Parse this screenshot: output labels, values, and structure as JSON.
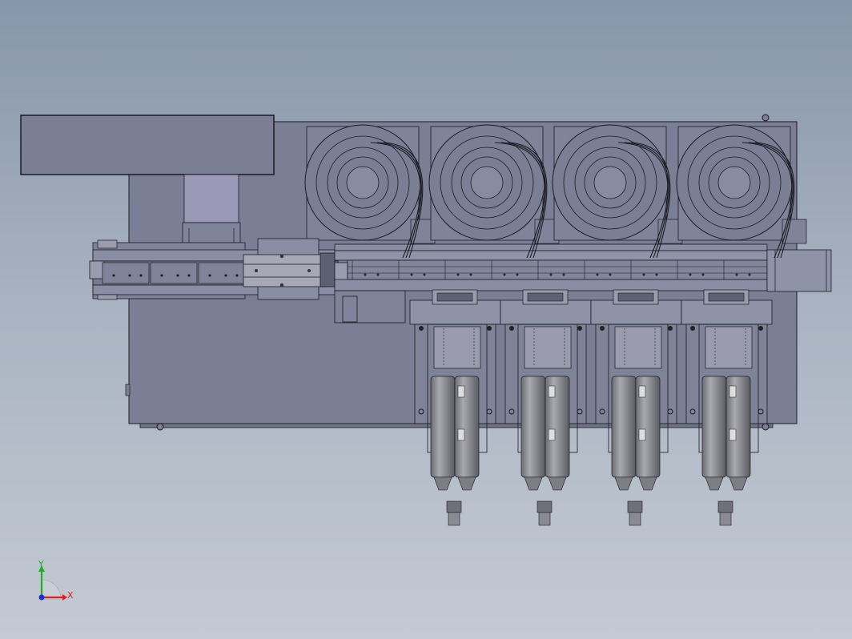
{
  "viewport": {
    "background_top": "#8796aa",
    "background_bottom": "#c4cad3"
  },
  "model": {
    "body_color": "#7b7f96",
    "panel_color": "#80849b",
    "line_color": "#1a1a22",
    "light_part_color": "#9a9cae",
    "metal_color": "#8e8f96",
    "dispenser_count": 4,
    "spool_count": 4
  },
  "triad": {
    "x_label": "X",
    "y_label": "Y",
    "x_color": "#e02020",
    "y_color": "#20b020",
    "z_color": "#2030d0"
  }
}
